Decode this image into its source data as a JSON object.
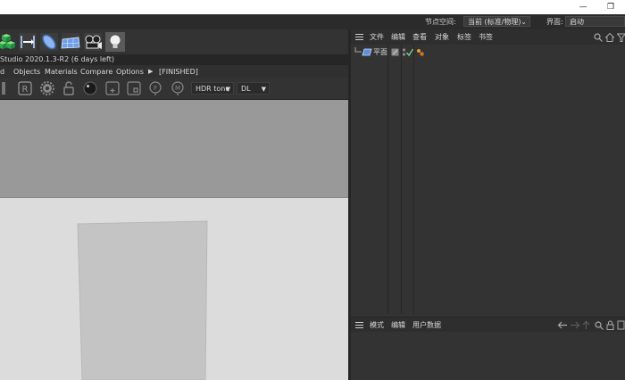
{
  "window": {
    "minimize_glyph": "—",
    "maximize_glyph": "❐"
  },
  "topbar": {
    "node_space_label": "节点空间:",
    "node_space_value": "当前 (标准/物理)",
    "layout_label": "界面:",
    "layout_value": "启动"
  },
  "toolbar_icons": [
    "cube-cluster-icon",
    "boundary-arrow-icon",
    "blue-capsule-icon",
    "blue-grid-icon",
    "camera-rig-icon",
    "light-bulb-icon"
  ],
  "renderer": {
    "title": "Studio 2020.1.3-R2 (6 days left)",
    "menu": [
      "d",
      "Objects",
      "Materials",
      "Compare",
      "Options"
    ],
    "status": "[FINISHED]",
    "tone_select": "HDR tone",
    "kernel_select": "DL"
  },
  "object_manager": {
    "menu": [
      "文件",
      "编辑",
      "查看",
      "对象",
      "标签",
      "书签"
    ],
    "objects": [
      {
        "name": "平面"
      }
    ]
  },
  "attribute_manager": {
    "menu": [
      "模式",
      "编辑",
      "用户数据"
    ]
  },
  "colors": {
    "panel": "#333333",
    "accent_blue": "#3b6fb8",
    "viewport": "#dcdcdc",
    "sky": "#999999"
  }
}
